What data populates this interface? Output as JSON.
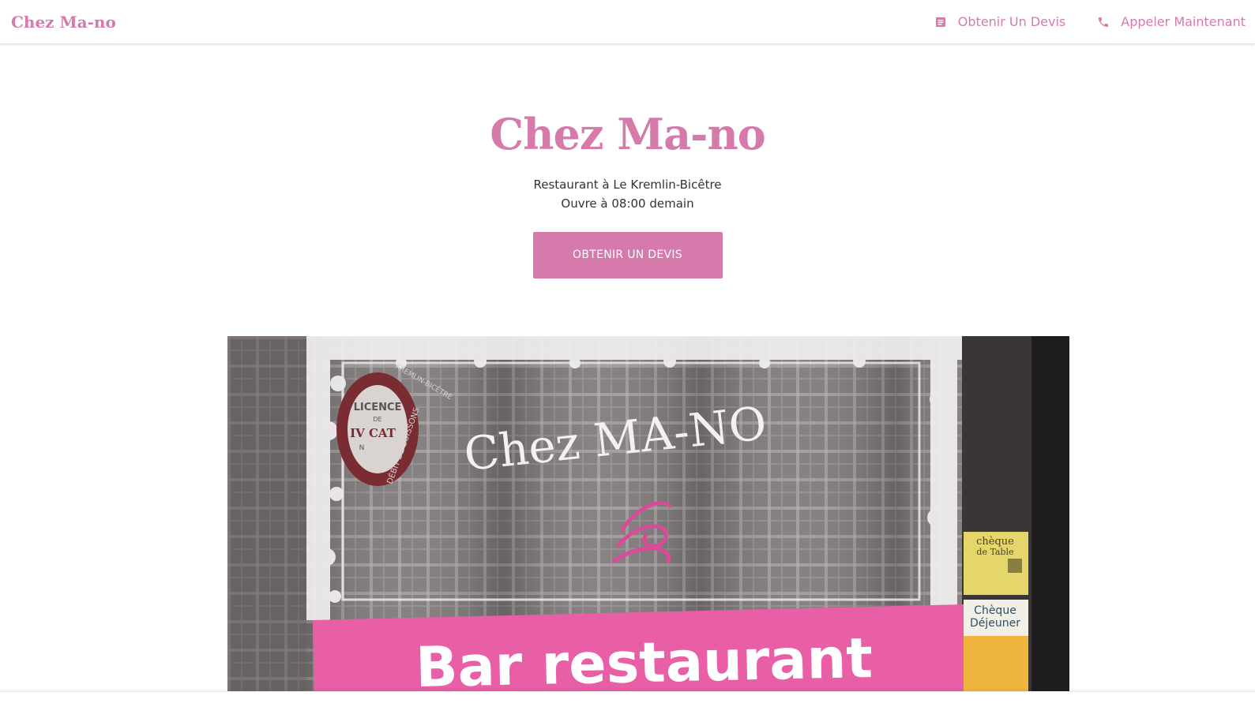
{
  "header": {
    "brand": "Chez Ma-no",
    "nav": [
      {
        "label": "Obtenir Un Devis",
        "icon": "document-icon"
      },
      {
        "label": "Appeler Maintenant",
        "icon": "phone-icon"
      }
    ]
  },
  "hero": {
    "title": "Chez Ma-no",
    "subtitle_line1": "Restaurant à Le Kremlin-Bicêtre",
    "subtitle_line2": "Ouvre à 08:00 demain",
    "cta_label": "OBTENIR UN DEVIS"
  },
  "photo": {
    "window_text": "Chez MA-NO",
    "banner_text": "Bar restaurant",
    "licence_lines": [
      "LICENCE",
      "DE",
      "IV CAT",
      "N"
    ],
    "licence_ring_top": "KREMLIN-BICÊTRE",
    "licence_ring_bottom": "DÉBIT DE BOISSONS",
    "sticker1_line1": "chèque",
    "sticker1_line2": "de Table",
    "sticker2_line1": "Chèque",
    "sticker2_line2": "Déjeuner"
  },
  "colors": {
    "accent": "#d57aab",
    "banner_pink": "#e85fa6"
  }
}
